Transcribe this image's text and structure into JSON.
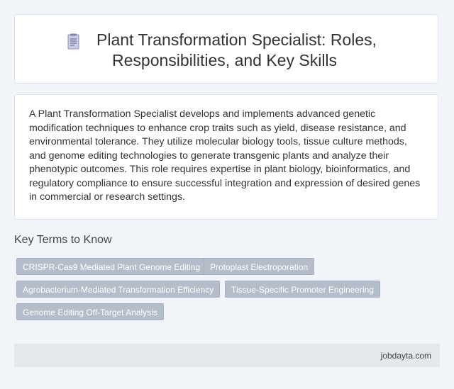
{
  "header": {
    "icon": "document-icon",
    "title_line1": "Plant Transformation Specialist: Roles,",
    "title_line2": "Responsibilities, and Key Skills"
  },
  "description": "A Plant Transformation Specialist develops and implements advanced genetic modification techniques to enhance crop traits such as yield, disease resistance, and environmental tolerance. They utilize molecular biology tools, tissue culture methods, and genome editing technologies to generate transgenic plants and analyze their phenotypic outcomes. This role requires expertise in plant biology, bioinformatics, and regulatory compliance to ensure successful integration and expression of desired genes in commercial or research settings.",
  "key_terms": {
    "heading": "Key Terms to Know",
    "tags": [
      "CRISPR-Cas9 Mediated Plant Genome Editing",
      "Protoplast Electroporation",
      "Agrobacterium-Mediated Transformation Efficiency",
      "Tissue-Specific Promoter Engineering",
      "Genome Editing Off-Target Analysis"
    ]
  },
  "footer": {
    "site": "jobdayta.com"
  },
  "colors": {
    "background": "#f1f4f8",
    "tag_background": "#b5bdcb",
    "footer_background": "#e3e8ec"
  }
}
